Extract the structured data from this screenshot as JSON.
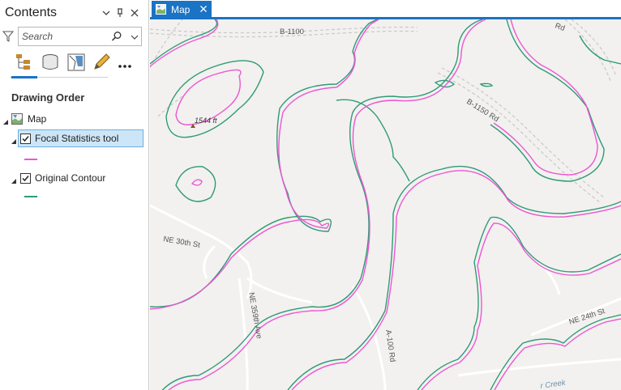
{
  "contents_pane": {
    "title": "Contents",
    "menu_icon": "chevron-down-icon",
    "pin_icon": "pin-icon",
    "close_icon": "close-icon",
    "search": {
      "placeholder": "Search",
      "value": ""
    },
    "view_buttons": [
      "list-by-drawing-order",
      "list-by-data-source",
      "list-by-selection",
      "list-by-editing",
      "more"
    ],
    "section_title": "Drawing Order",
    "tree": {
      "map_label": "Map",
      "layers": [
        {
          "label": "Focal Statistics tool",
          "checked": true,
          "selected": true,
          "swatch_color": "#ee55d4"
        },
        {
          "label": "Original Contour",
          "checked": true,
          "selected": false,
          "swatch_color": "#2f9a78"
        }
      ]
    }
  },
  "map_view": {
    "tab_label": "Map",
    "accent_color": "#1a73c5",
    "labels": {
      "road_b1100": "B-1100",
      "road_b1150": "B-1150 Rd",
      "road_ne30": "NE 30th St",
      "road_ne359": "NE 359th Ave",
      "road_a100": "A-100 Rd",
      "road_ne24": "NE 24th St",
      "road_top_right": "Rd",
      "creek": "r Creek",
      "elevation": "1544 ft"
    },
    "colors": {
      "original_contour": "#2f9a78",
      "focal_statistics": "#ee55d4",
      "basemap": "#f2f1ef",
      "roads": "#ffffff"
    }
  }
}
